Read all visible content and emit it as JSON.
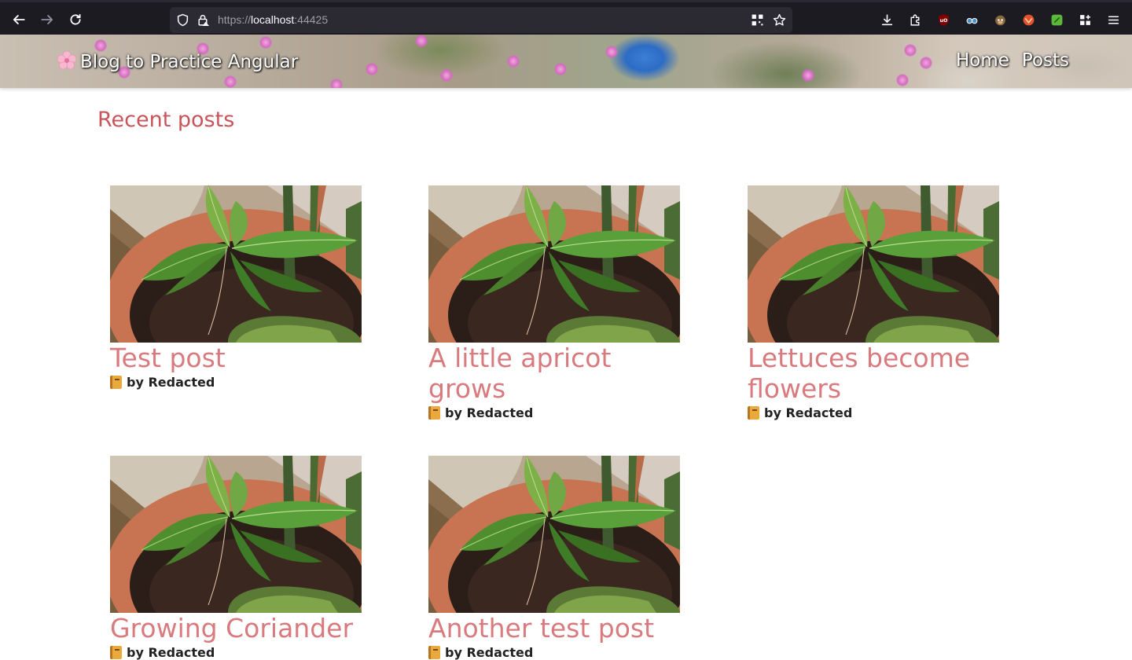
{
  "browser": {
    "url_prefix": "https://",
    "url_host": "localhost",
    "url_port": ":44425"
  },
  "site": {
    "title": "Blog to Practice Angular",
    "nav": [
      {
        "label": "Home"
      },
      {
        "label": "Posts"
      }
    ]
  },
  "main": {
    "heading": "Recent posts",
    "posts": [
      {
        "title": "Test post",
        "author": "by Redacted"
      },
      {
        "title": "A little apricot grows",
        "author": "by Redacted"
      },
      {
        "title": "Lettuces become flowers",
        "author": "by Redacted"
      },
      {
        "title": "Growing Coriander",
        "author": "by Redacted"
      },
      {
        "title": "Another test post",
        "author": "by Redacted"
      }
    ]
  },
  "colors": {
    "heading": "#c8555a",
    "post_title": "#d97a7e",
    "browser_bg": "#1c1b22"
  }
}
